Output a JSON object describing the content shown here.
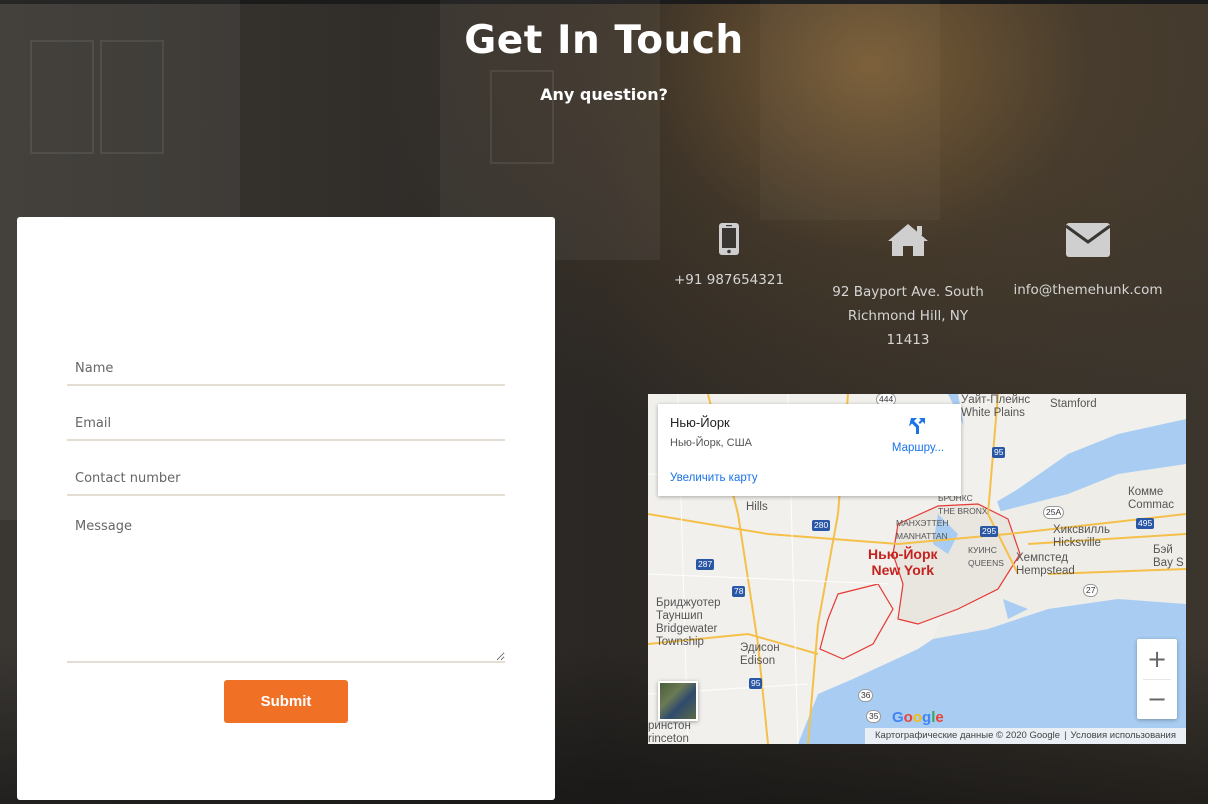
{
  "header": {
    "title": "Get In Touch",
    "subtitle": "Any question?"
  },
  "form": {
    "name_placeholder": "Name",
    "email_placeholder": "Email",
    "contact_placeholder": "Contact number",
    "message_placeholder": "Message",
    "submit_label": "Submit"
  },
  "contact": {
    "phone": "+91 987654321",
    "address_line1": "92 Bayport Ave. South",
    "address_line2": "Richmond Hill, NY",
    "address_line3": "11413",
    "email": "info@themehunk.com",
    "icons": [
      "phone-icon",
      "home-icon",
      "envelope-icon"
    ]
  },
  "map": {
    "place_title": "Нью-Йорк",
    "place_subtitle": "Нью-Йорк, США",
    "directions_label": "Маршру...",
    "enlarge_link": "Увеличить карту",
    "zoom_in": "+",
    "zoom_out": "−",
    "attribution": "Картографические данные © 2020 Google",
    "terms": "Условия использования",
    "google_logo": "Google",
    "labels": {
      "city_ru": "Нью-Йорк",
      "city_en": "New York",
      "white_plains_ru": "Уайт-Плейнс",
      "white_plains_en": "White Plains",
      "stamford": "Stamford",
      "bronx_ru": "БРОНКС",
      "bronx_en": "THE BRONX",
      "manhattan_ru": "МАНХЭТТЕН",
      "manhattan_en": "MANHATTAN",
      "queens_ru": "КУИНС",
      "queens_en": "QUEENS",
      "hicksville_ru": "Хиксвилль",
      "hicksville_en": "Hicksville",
      "hempstead_ru": "Хемпстед",
      "hempstead_en": "Hempstead",
      "bridgewater_ru": "Бриджуотер",
      "bridgewater_ru2": "Тауншип",
      "bridgewater_en": "Bridgewater",
      "bridgewater_en2": "Township",
      "edison_ru": "Эдисон",
      "edison_en": "Edison",
      "hills": "Hills",
      "commack_ru": "Комме",
      "commack_en": "Commac",
      "bay_ru": "Бэй",
      "bay_en": "Bay S",
      "princeton_ru": "ринстон",
      "princeton_en": "rinceton"
    },
    "shields": [
      "444",
      "95",
      "280",
      "287",
      "78",
      "295",
      "25A",
      "495",
      "27",
      "95",
      "36",
      "35"
    ],
    "colors": {
      "water": "#a9cdf2",
      "land": "#f1f0ec",
      "city_border": "#e53935",
      "road": "#f5c04a"
    }
  },
  "colors": {
    "accent": "#f07025",
    "title": "#ffffff",
    "info_text": "#d5d5d5",
    "icon": "#cfcfcf"
  }
}
